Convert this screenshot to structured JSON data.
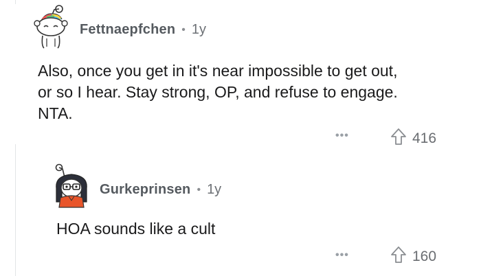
{
  "comments": [
    {
      "author": "Fettnaepfchen",
      "separator": "•",
      "age": "1y",
      "body_lines": [
        "Also, once you get in it's near impossible to get out,",
        "or so I hear. Stay strong, OP, and refuse to engage.",
        "NTA."
      ],
      "more_label": "•••",
      "score": "416"
    },
    {
      "author": "Gurkeprinsen",
      "separator": "•",
      "age": "1y",
      "body_lines": [
        "HOA sounds like a cult"
      ],
      "more_label": "•••",
      "score": "160"
    }
  ],
  "icons": {
    "upvote": "upvote-arrow-icon",
    "more": "more-options-icon"
  },
  "colors": {
    "author": "#555a5f",
    "meta": "#6c7075",
    "thread_line": "#e2e4e6",
    "avatar2_shirt": "#e8552a",
    "avatar1_hair": "#3db4e8"
  }
}
